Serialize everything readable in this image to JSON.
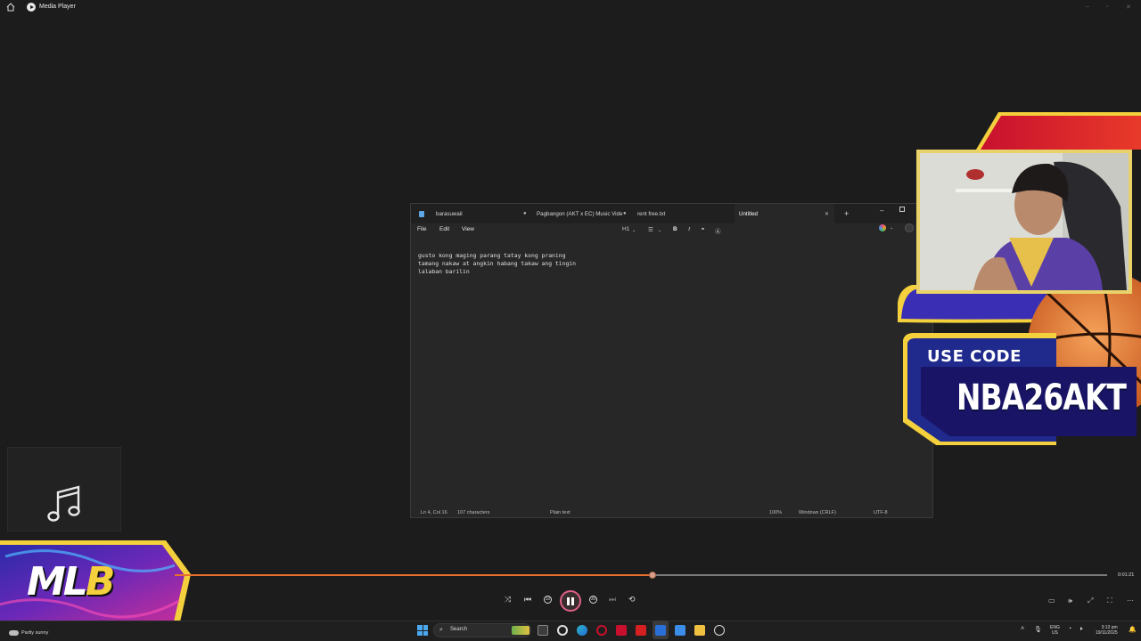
{
  "media_player": {
    "title": "Media Player",
    "window_controls": [
      "–",
      "▫",
      "✕"
    ],
    "current_time": "0:01:21",
    "progress": 0.512,
    "accent_color": "#e76f2e",
    "controls": {
      "shuffle_icon": "shuffle-icon",
      "previous_icon": "previous-icon",
      "rewind_label": "10",
      "forward_label": "30",
      "next_icon": "next-icon",
      "repeat_icon": "repeat-off-icon",
      "play_state": "playing"
    }
  },
  "notepad": {
    "tabs": [
      {
        "label": "barasuwail",
        "active": false
      },
      {
        "label": "Pagbangon (AKT x EC) Music Vide",
        "active": false
      },
      {
        "label": "rent free.txt",
        "active": false
      },
      {
        "label": "Untitled",
        "active": true
      }
    ],
    "menu": [
      "File",
      "Edit",
      "View"
    ],
    "format": {
      "heading": "H1",
      "list": "☰",
      "bold": "B",
      "italic": "I",
      "link": "🔗",
      "clear": "A̸"
    },
    "lines": [
      "gusto kong maging parang tatay kong praning",
      "tamang nakaw at angkin habang takaw ang tingin",
      "lalaban barilin"
    ],
    "status": {
      "position": "Ln 4, Col 16",
      "chars": "107 characters",
      "format": "Plain text",
      "zoom": "100%",
      "line_ending": "Windows (CRLF)",
      "encoding": "UTF-8"
    }
  },
  "overlay_mlb": {
    "text_main": "ML",
    "text_accent": "B"
  },
  "overlay_nba": {
    "use_code_label": "USE CODE",
    "code": "NBA26AKT"
  },
  "taskbar": {
    "weather": "Partly sunny",
    "search_label": "Search",
    "lang_top": "ENG",
    "lang_bottom": "US",
    "time": "3:13 pm",
    "date": "19/11/2025"
  }
}
